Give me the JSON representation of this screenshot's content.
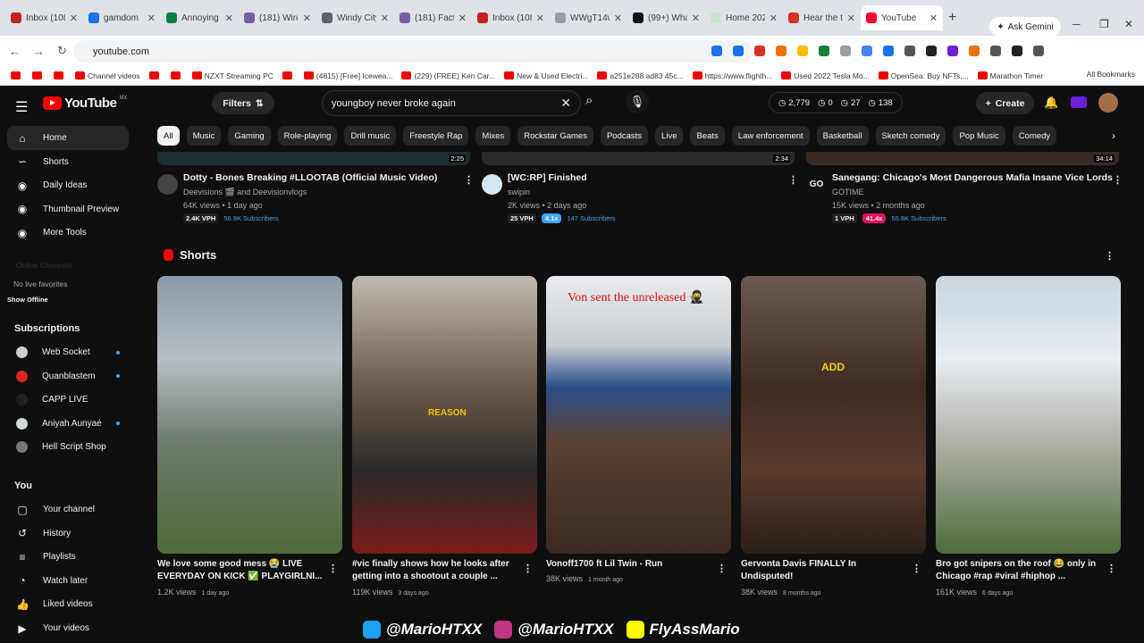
{
  "browser": {
    "tabs": [
      {
        "title": "Inbox (108...",
        "color": "#c5221f"
      },
      {
        "title": "gamdom",
        "color": "#1a73e8"
      },
      {
        "title": "Annoying S",
        "color": "#0b8043"
      },
      {
        "title": "(181) Wind",
        "color": "#7b5ea7"
      },
      {
        "title": "Windy City",
        "color": "#5f6368"
      },
      {
        "title": "(181) Facti",
        "color": "#7b5ea7"
      },
      {
        "title": "Inbox (108",
        "color": "#c5221f"
      },
      {
        "title": "WWgT14w",
        "color": "#9aa0a6"
      },
      {
        "title": "(99+) What",
        "color": "#111111"
      },
      {
        "title": "Home 2024",
        "color": "#c8e6c9"
      },
      {
        "title": "Hear the ti",
        "color": "#d93025"
      },
      {
        "title": "YouTube",
        "color": "#ff0033",
        "active": true
      }
    ],
    "new_tab": "+",
    "gemini": "Ask Gemini",
    "url": "youtube.com",
    "bookmarks": [
      "",
      "",
      "",
      "Channel videos",
      "",
      "",
      "NZXT Streaming PC",
      "",
      "(4815) [Free] Icewea...",
      "(229) (FREE) Ken Car...",
      "New & Used Electri...",
      "a251e288 ad83 45c...",
      "https://www.flighth...",
      "Used 2022 Tesla Mo...",
      "OpenSea: Buy NFTs,...",
      "Marathon Timer"
    ],
    "all_bookmarks": "All Bookmarks"
  },
  "header": {
    "logo": "YouTube",
    "logo_region": "MX",
    "filters": "Filters",
    "search_value": "youngboy never broke again",
    "stats": [
      "2,779",
      "0",
      "27",
      "138"
    ],
    "create": "Create"
  },
  "sidebar": {
    "top": [
      {
        "label": "Home",
        "icon": "home-icon",
        "active": true
      },
      {
        "label": "Shorts",
        "icon": "shorts-icon"
      },
      {
        "label": "Daily Ideas",
        "icon": "ideas-icon"
      },
      {
        "label": "Thumbnail Preview",
        "icon": "preview-icon"
      },
      {
        "label": "More Tools",
        "icon": "tools-icon"
      }
    ],
    "live_header": "Online Channels",
    "no_live": "No live favorites",
    "show_offline": "Show Offline",
    "subscriptions_title": "Subscriptions",
    "subscriptions": [
      {
        "label": "Web Socket",
        "color": "#d0d0d0",
        "dot": true
      },
      {
        "label": "Quanblastem",
        "color": "#d7261e",
        "dot": true
      },
      {
        "label": "CAPP LIVE",
        "color": "#222222",
        "dot": false
      },
      {
        "label": "Aniyah Aunyaé",
        "color": "#cfd8dc",
        "dot": true
      },
      {
        "label": "Hell Script Shop",
        "color": "#777777",
        "dot": false
      }
    ],
    "you_title": "You",
    "you": [
      {
        "label": "Your channel",
        "icon": "channel-icon"
      },
      {
        "label": "History",
        "icon": "history-icon"
      },
      {
        "label": "Playlists",
        "icon": "playlists-icon"
      },
      {
        "label": "Watch later",
        "icon": "watch-later-icon"
      },
      {
        "label": "Liked videos",
        "icon": "liked-icon"
      },
      {
        "label": "Your videos",
        "icon": "videos-icon"
      }
    ]
  },
  "chips": [
    "All",
    "Music",
    "Gaming",
    "Role-playing",
    "Drill music",
    "Freestyle Rap",
    "Mixes",
    "Rockstar Games",
    "Podcasts",
    "Live",
    "Beats",
    "Law enforcement",
    "Basketball",
    "Sketch comedy",
    "Pop Music",
    "Comedy"
  ],
  "videos": [
    {
      "title": "Dotty - Bones Breaking #LLOOTAB (Official Music Video)",
      "channel": "Deevisions 🎬 and Deevisionvlogs",
      "meta": "64K views • 1 day ago",
      "vph": "2.4K VPH",
      "mult": "",
      "subs": "56.9K Subscribers",
      "duration": "2:25",
      "mult_color": "#1f1f1f"
    },
    {
      "title": "[WC:RP] Finished",
      "channel": "swipin",
      "meta": "2K views • 2 days ago",
      "vph": "25 VPH",
      "mult": "4.1x",
      "subs": "147 Subscribers",
      "duration": "2:34",
      "mult_color": "#3ea6ff"
    },
    {
      "title": "Sanegang: Chicago's Most Dangerous Mafia Insane Vice Lords",
      "channel": "GOTIME",
      "meta": "15K views • 2 months ago",
      "vph": "1 VPH",
      "mult": "41.4x",
      "subs": "55.8K Subscribers",
      "duration": "34:14",
      "mult_color": "#e0115f",
      "avatar_text": "GO"
    }
  ],
  "shorts_title": "Shorts",
  "shorts": [
    {
      "title1": "We love some good mess 😭 LIVE",
      "title2": "EVERYDAY ON KICK ✅ PLAYGIRLNI...",
      "views": "1.2K views",
      "ago": "1 day ago",
      "overlay": ""
    },
    {
      "title1": "#vic finally shows how he looks after",
      "title2": "getting into a shootout a couple ...",
      "views": "119K views",
      "ago": "3 days ago",
      "overlay": "REASON"
    },
    {
      "title1": "Vonoff1700 ft Lil Twin - Run",
      "title2": "",
      "views": "38K views",
      "ago": "1 month ago",
      "overlay": "Von sent the unreleased 🥷"
    },
    {
      "title1": "Gervonta Davis FINALLY In",
      "title2": "Undisputed!",
      "views": "38K views",
      "ago": "8 months ago",
      "overlay": "ADD"
    },
    {
      "title1": "Bro got snipers on the roof 😂 only in",
      "title2": "Chicago #rap #viral #hiphop ...",
      "views": "161K views",
      "ago": "6 days ago",
      "overlay": ""
    }
  ],
  "watermark": [
    "@MarioHTXX",
    "@MarioHTXX",
    "FlyAssMario"
  ]
}
